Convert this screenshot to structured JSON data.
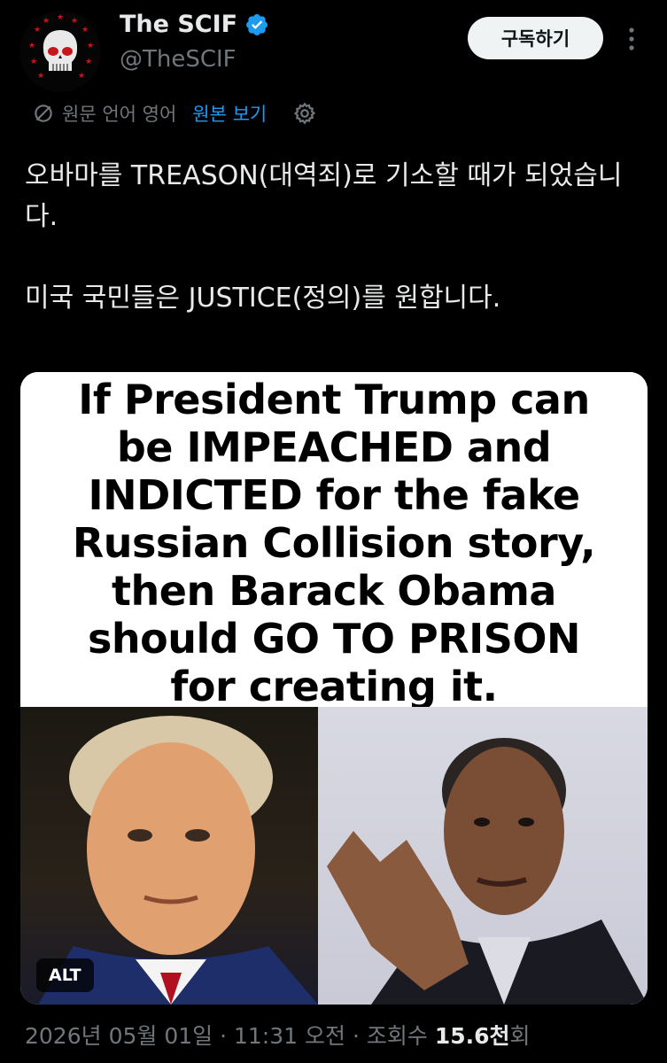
{
  "author": {
    "display_name": "The SCIF",
    "handle": "@TheSCIF",
    "verified": true,
    "avatar_icon": "skull-stars-avatar"
  },
  "header": {
    "subscribe_label": "구독하기",
    "more_icon": "more-vertical-icon"
  },
  "translation": {
    "icon": "translate-icon",
    "source_language_label": "원문 언어 영어",
    "show_original_label": "원본 보기",
    "settings_icon": "gear-icon"
  },
  "tweet": {
    "paragraph_1": "오바마를 TREASON(대역죄)로 기소할 때가 되었습니다.",
    "paragraph_2": "미국 국민들은 JUSTICE(정의)를 원합니다."
  },
  "media": {
    "meme_lines": [
      "If President Trump can",
      "be IMPEACHED and",
      "INDICTED for the fake",
      "Russian Collision story,",
      "then Barack Obama",
      "should GO TO PRISON",
      "for creating it."
    ],
    "alt_label": "ALT"
  },
  "meta": {
    "date": "2026년 05월 01일",
    "separator": "·",
    "time": "11:31 오전",
    "views_prefix": "조회수",
    "views_count": "15.6천",
    "views_suffix": "회"
  },
  "colors": {
    "background": "#000000",
    "text_primary": "#e7e9ea",
    "text_secondary": "#71767b",
    "accent": "#1d9bf0"
  }
}
